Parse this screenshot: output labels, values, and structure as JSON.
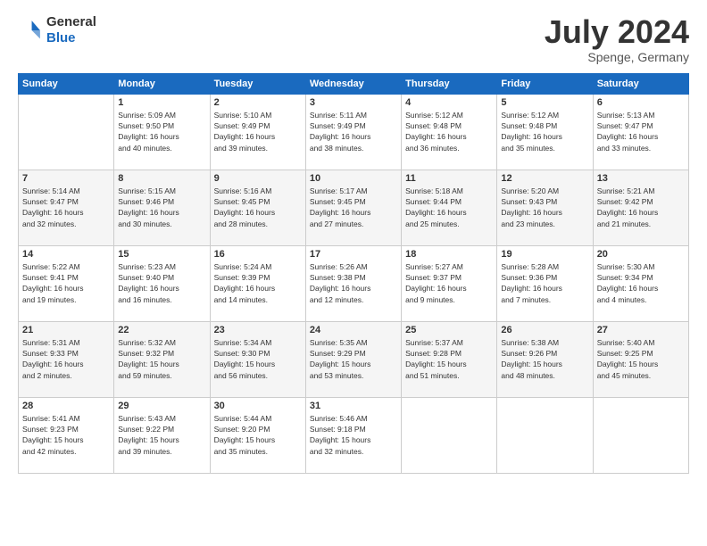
{
  "header": {
    "logo_general": "General",
    "logo_blue": "Blue",
    "month_year": "July 2024",
    "location": "Spenge, Germany"
  },
  "weekdays": [
    "Sunday",
    "Monday",
    "Tuesday",
    "Wednesday",
    "Thursday",
    "Friday",
    "Saturday"
  ],
  "weeks": [
    [
      {
        "day": "",
        "info": ""
      },
      {
        "day": "1",
        "info": "Sunrise: 5:09 AM\nSunset: 9:50 PM\nDaylight: 16 hours\nand 40 minutes."
      },
      {
        "day": "2",
        "info": "Sunrise: 5:10 AM\nSunset: 9:49 PM\nDaylight: 16 hours\nand 39 minutes."
      },
      {
        "day": "3",
        "info": "Sunrise: 5:11 AM\nSunset: 9:49 PM\nDaylight: 16 hours\nand 38 minutes."
      },
      {
        "day": "4",
        "info": "Sunrise: 5:12 AM\nSunset: 9:48 PM\nDaylight: 16 hours\nand 36 minutes."
      },
      {
        "day": "5",
        "info": "Sunrise: 5:12 AM\nSunset: 9:48 PM\nDaylight: 16 hours\nand 35 minutes."
      },
      {
        "day": "6",
        "info": "Sunrise: 5:13 AM\nSunset: 9:47 PM\nDaylight: 16 hours\nand 33 minutes."
      }
    ],
    [
      {
        "day": "7",
        "info": "Sunrise: 5:14 AM\nSunset: 9:47 PM\nDaylight: 16 hours\nand 32 minutes."
      },
      {
        "day": "8",
        "info": "Sunrise: 5:15 AM\nSunset: 9:46 PM\nDaylight: 16 hours\nand 30 minutes."
      },
      {
        "day": "9",
        "info": "Sunrise: 5:16 AM\nSunset: 9:45 PM\nDaylight: 16 hours\nand 28 minutes."
      },
      {
        "day": "10",
        "info": "Sunrise: 5:17 AM\nSunset: 9:45 PM\nDaylight: 16 hours\nand 27 minutes."
      },
      {
        "day": "11",
        "info": "Sunrise: 5:18 AM\nSunset: 9:44 PM\nDaylight: 16 hours\nand 25 minutes."
      },
      {
        "day": "12",
        "info": "Sunrise: 5:20 AM\nSunset: 9:43 PM\nDaylight: 16 hours\nand 23 minutes."
      },
      {
        "day": "13",
        "info": "Sunrise: 5:21 AM\nSunset: 9:42 PM\nDaylight: 16 hours\nand 21 minutes."
      }
    ],
    [
      {
        "day": "14",
        "info": "Sunrise: 5:22 AM\nSunset: 9:41 PM\nDaylight: 16 hours\nand 19 minutes."
      },
      {
        "day": "15",
        "info": "Sunrise: 5:23 AM\nSunset: 9:40 PM\nDaylight: 16 hours\nand 16 minutes."
      },
      {
        "day": "16",
        "info": "Sunrise: 5:24 AM\nSunset: 9:39 PM\nDaylight: 16 hours\nand 14 minutes."
      },
      {
        "day": "17",
        "info": "Sunrise: 5:26 AM\nSunset: 9:38 PM\nDaylight: 16 hours\nand 12 minutes."
      },
      {
        "day": "18",
        "info": "Sunrise: 5:27 AM\nSunset: 9:37 PM\nDaylight: 16 hours\nand 9 minutes."
      },
      {
        "day": "19",
        "info": "Sunrise: 5:28 AM\nSunset: 9:36 PM\nDaylight: 16 hours\nand 7 minutes."
      },
      {
        "day": "20",
        "info": "Sunrise: 5:30 AM\nSunset: 9:34 PM\nDaylight: 16 hours\nand 4 minutes."
      }
    ],
    [
      {
        "day": "21",
        "info": "Sunrise: 5:31 AM\nSunset: 9:33 PM\nDaylight: 16 hours\nand 2 minutes."
      },
      {
        "day": "22",
        "info": "Sunrise: 5:32 AM\nSunset: 9:32 PM\nDaylight: 15 hours\nand 59 minutes."
      },
      {
        "day": "23",
        "info": "Sunrise: 5:34 AM\nSunset: 9:30 PM\nDaylight: 15 hours\nand 56 minutes."
      },
      {
        "day": "24",
        "info": "Sunrise: 5:35 AM\nSunset: 9:29 PM\nDaylight: 15 hours\nand 53 minutes."
      },
      {
        "day": "25",
        "info": "Sunrise: 5:37 AM\nSunset: 9:28 PM\nDaylight: 15 hours\nand 51 minutes."
      },
      {
        "day": "26",
        "info": "Sunrise: 5:38 AM\nSunset: 9:26 PM\nDaylight: 15 hours\nand 48 minutes."
      },
      {
        "day": "27",
        "info": "Sunrise: 5:40 AM\nSunset: 9:25 PM\nDaylight: 15 hours\nand 45 minutes."
      }
    ],
    [
      {
        "day": "28",
        "info": "Sunrise: 5:41 AM\nSunset: 9:23 PM\nDaylight: 15 hours\nand 42 minutes."
      },
      {
        "day": "29",
        "info": "Sunrise: 5:43 AM\nSunset: 9:22 PM\nDaylight: 15 hours\nand 39 minutes."
      },
      {
        "day": "30",
        "info": "Sunrise: 5:44 AM\nSunset: 9:20 PM\nDaylight: 15 hours\nand 35 minutes."
      },
      {
        "day": "31",
        "info": "Sunrise: 5:46 AM\nSunset: 9:18 PM\nDaylight: 15 hours\nand 32 minutes."
      },
      {
        "day": "",
        "info": ""
      },
      {
        "day": "",
        "info": ""
      },
      {
        "day": "",
        "info": ""
      }
    ]
  ]
}
